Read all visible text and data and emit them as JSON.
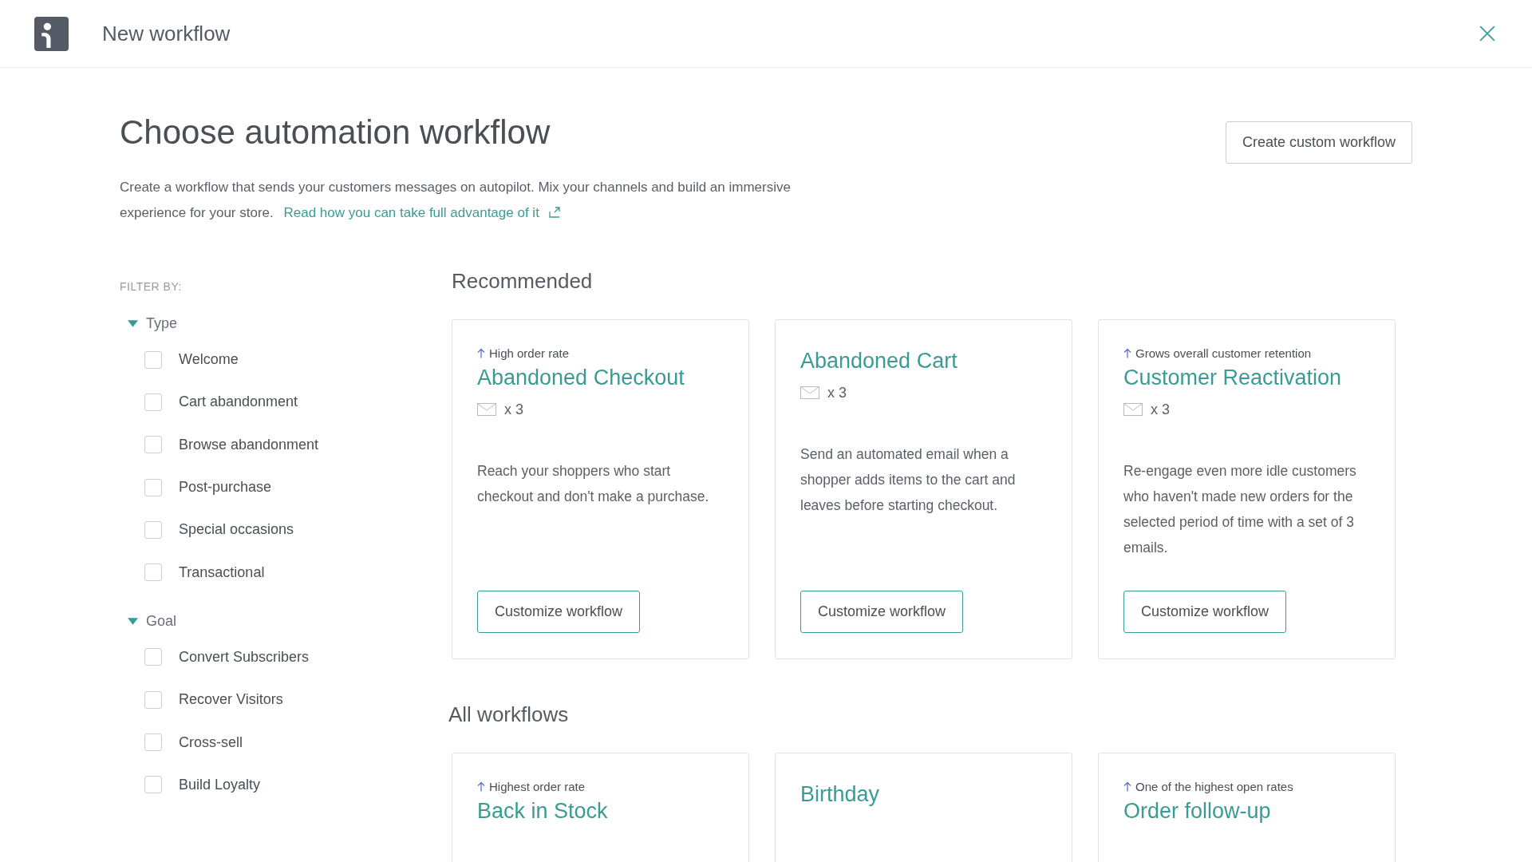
{
  "header": {
    "title": "New workflow"
  },
  "page": {
    "heading": "Choose automation workflow",
    "create_button": "Create custom workflow",
    "description": "Create a workflow that sends your customers messages on autopilot. Mix your channels and build an immersive experience for your store.",
    "link": "Read how you can take full advantage of it"
  },
  "filter": {
    "label": "FILTER BY:",
    "groups": [
      {
        "title": "Type",
        "expanded": true,
        "options": [
          {
            "label": "Welcome",
            "checked": false
          },
          {
            "label": "Cart abandonment",
            "checked": false
          },
          {
            "label": "Browse abandonment",
            "checked": false
          },
          {
            "label": "Post-purchase",
            "checked": false
          },
          {
            "label": "Special occasions",
            "checked": false
          },
          {
            "label": "Transactional",
            "checked": false
          }
        ]
      },
      {
        "title": "Goal",
        "expanded": true,
        "options": [
          {
            "label": "Convert Subscribers",
            "checked": false
          },
          {
            "label": "Recover Visitors",
            "checked": false
          },
          {
            "label": "Cross-sell",
            "checked": false
          },
          {
            "label": "Build Loyalty",
            "checked": false
          }
        ]
      }
    ]
  },
  "sections": [
    {
      "title": "Recommended",
      "cards": [
        {
          "tag": "High order rate",
          "title": "Abandoned Checkout",
          "emails": "x 3",
          "description": "Reach your shoppers who start checkout and don't make a purchase.",
          "button": "Customize workflow"
        },
        {
          "title": "Abandoned Cart",
          "emails": "x 3",
          "description": "Send an automated email when a shopper adds items to the cart and leaves before starting checkout.",
          "button": "Customize workflow"
        },
        {
          "tag": "Grows overall customer retention",
          "title": "Customer Reactivation",
          "emails": "x 3",
          "description": "Re-engage even more idle customers who haven't made new orders for the selected period of time with a set of 3 emails.",
          "button": "Customize workflow"
        }
      ]
    },
    {
      "title": "All workflows",
      "cards": [
        {
          "tag": "Highest order rate",
          "title": "Back in Stock"
        },
        {
          "title": "Birthday"
        },
        {
          "tag": "One of the highest open rates",
          "title": "Order follow-up"
        }
      ]
    }
  ]
}
